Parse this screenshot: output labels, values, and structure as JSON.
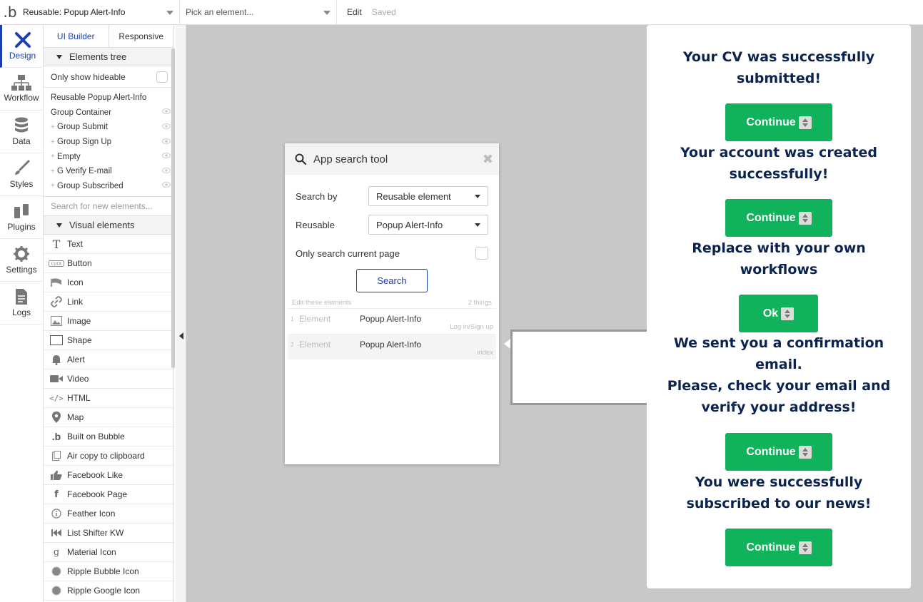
{
  "topbar": {
    "page": "Reusable: Popup Alert-Info",
    "element_placeholder": "Pick an element...",
    "edit": "Edit",
    "status": "Saved"
  },
  "rail": {
    "items": [
      {
        "label": "Design",
        "icon": "design-icon"
      },
      {
        "label": "Workflow",
        "icon": "workflow-icon"
      },
      {
        "label": "Data",
        "icon": "database-icon"
      },
      {
        "label": "Styles",
        "icon": "brush-icon"
      },
      {
        "label": "Plugins",
        "icon": "plug-icon"
      },
      {
        "label": "Settings",
        "icon": "gear-icon"
      },
      {
        "label": "Logs",
        "icon": "document-icon"
      }
    ]
  },
  "panel": {
    "tabs": [
      "UI Builder",
      "Responsive"
    ],
    "elements_tree": "Elements tree",
    "only_hideable": "Only show hideable",
    "tree": [
      {
        "label": "Reusable Popup Alert-Info",
        "plus": false,
        "eye": false
      },
      {
        "label": "Group Container",
        "plus": false,
        "eye": true
      },
      {
        "label": "Group Submit",
        "plus": true,
        "eye": true
      },
      {
        "label": "Group Sign Up",
        "plus": true,
        "eye": true
      },
      {
        "label": "Empty",
        "plus": true,
        "eye": true
      },
      {
        "label": "G Verify E-mail",
        "plus": true,
        "eye": true
      },
      {
        "label": "Group Subscribed",
        "plus": true,
        "eye": true
      }
    ],
    "search_placeholder": "Search for new elements...",
    "visual_elements": "Visual elements",
    "elements": [
      {
        "label": "Text",
        "icon": "text-icon"
      },
      {
        "label": "Button",
        "icon": "button-icon"
      },
      {
        "label": "Icon",
        "icon": "flag-icon"
      },
      {
        "label": "Link",
        "icon": "link-icon"
      },
      {
        "label": "Image",
        "icon": "image-icon"
      },
      {
        "label": "Shape",
        "icon": "shape-icon"
      },
      {
        "label": "Alert",
        "icon": "bell-icon"
      },
      {
        "label": "Video",
        "icon": "video-icon"
      },
      {
        "label": "HTML",
        "icon": "code-icon"
      },
      {
        "label": "Map",
        "icon": "map-pin-icon"
      },
      {
        "label": "Built on Bubble",
        "icon": "bubble-icon"
      },
      {
        "label": "Air copy to clipboard",
        "icon": "clipboard-icon"
      },
      {
        "label": "Facebook Like",
        "icon": "thumbs-up-icon"
      },
      {
        "label": "Facebook Page",
        "icon": "facebook-icon"
      },
      {
        "label": "Feather Icon",
        "icon": "info-icon"
      },
      {
        "label": "List Shifter KW",
        "icon": "rewind-icon"
      },
      {
        "label": "Material Icon",
        "icon": "material-icon"
      },
      {
        "label": "Ripple Bubble Icon",
        "icon": "ripple-icon"
      },
      {
        "label": "Ripple Google Icon",
        "icon": "ripple-icon"
      }
    ]
  },
  "search_tool": {
    "title": "App search tool",
    "search_by_label": "Search by",
    "search_by_value": "Reusable element",
    "reusable_label": "Reusable",
    "reusable_value": "Popup Alert-Info",
    "only_current": "Only search current page",
    "button": "Search",
    "edit_these": "Edit these elements",
    "count": "2 things",
    "results": [
      {
        "num": "1",
        "type": "Element",
        "name": "Popup Alert-Info",
        "page": "Log in/Sign up"
      },
      {
        "num": "2",
        "type": "Element",
        "name": "Popup Alert-Info",
        "page": "index"
      }
    ]
  },
  "popup": {
    "msg1_line1": "Your CV was successfully",
    "msg1_line2": "submitted!",
    "btn1": "Continue",
    "msg2_line1": "Your account was created",
    "msg2_line2": "successfully!",
    "btn2": "Continue",
    "msg3_line1": "Replace with your own",
    "msg3_line2": "workflows",
    "btn3": "Ok",
    "msg4_line1": "We sent you a confirmation",
    "msg4_line2": "email.",
    "msg4_line3": "Please, check your email and",
    "msg4_line4": "verify your address!",
    "btn4": "Continue",
    "msg5_line1": "You were successfully",
    "msg5_line2": "subscribed to our news!",
    "btn5": "Continue"
  },
  "colors": {
    "accent": "#1a3fb0",
    "green": "#10b25c",
    "navy": "#0b2350",
    "canvas": "#c8c8c8"
  }
}
